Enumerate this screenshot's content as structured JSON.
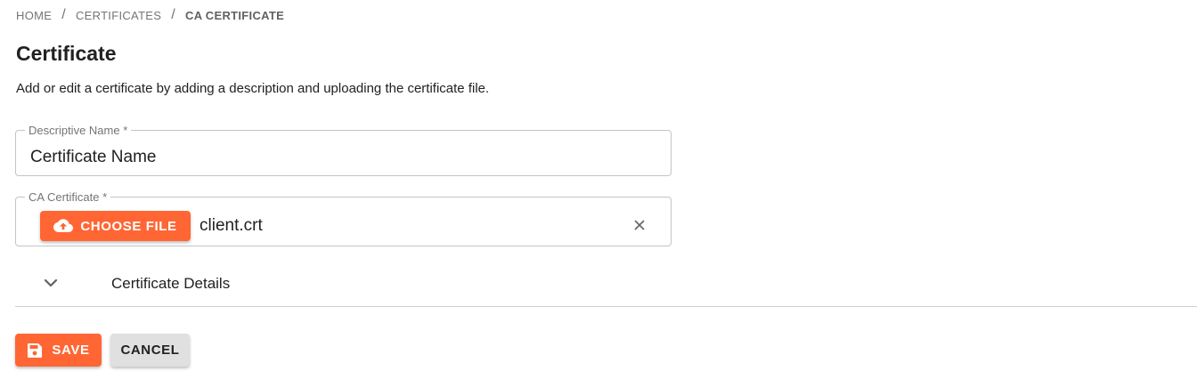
{
  "breadcrumb": {
    "items": [
      "HOME",
      "CERTIFICATES",
      "CA CERTIFICATE"
    ],
    "separator": "/"
  },
  "page": {
    "title": "Certificate",
    "description": "Add or edit a certificate by adding a description and uploading the certificate file."
  },
  "form": {
    "name_field": {
      "label": "Descriptive Name *",
      "value": "Certificate Name"
    },
    "cert_field": {
      "label": "CA Certificate *",
      "choose_label": "CHOOSE FILE",
      "choose_icon": "cloud-upload-icon",
      "file_name": "client.crt",
      "clear_icon": "close-icon"
    }
  },
  "details": {
    "label": "Certificate Details",
    "icon": "chevron-down-icon"
  },
  "actions": {
    "save_label": "SAVE",
    "save_icon": "save-icon",
    "cancel_label": "CANCEL"
  },
  "colors": {
    "accent": "#ff6634",
    "secondary_button": "#e0e0e0"
  }
}
